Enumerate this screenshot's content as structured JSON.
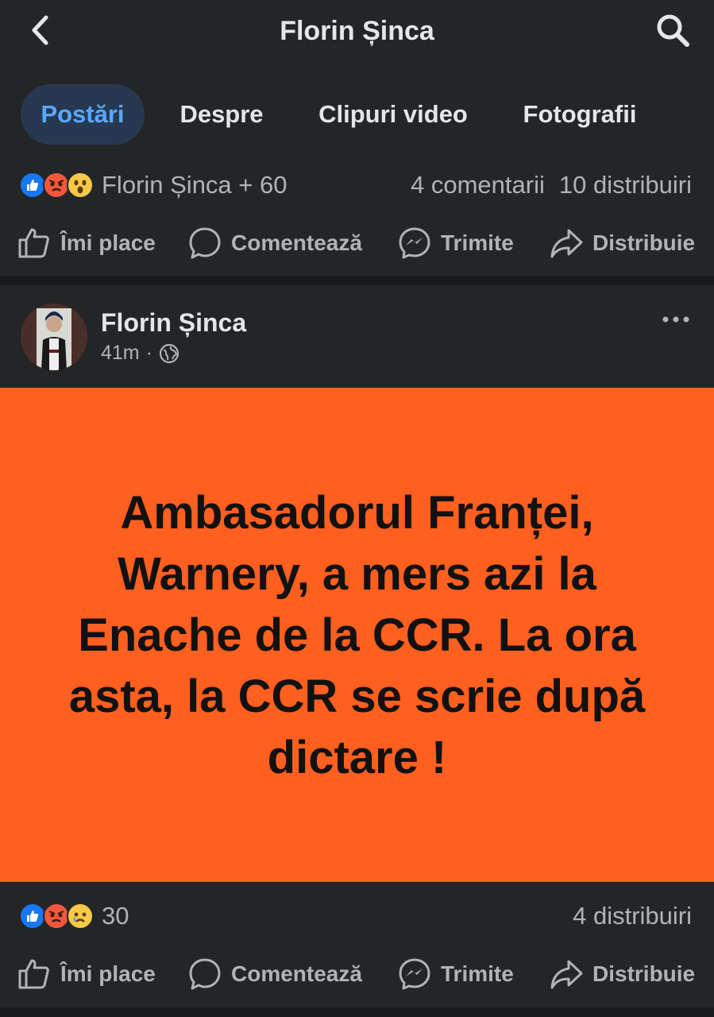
{
  "header": {
    "title": "Florin Șinca"
  },
  "tabs": [
    {
      "label": "Postări",
      "active": true
    },
    {
      "label": "Despre"
    },
    {
      "label": "Clipuri video"
    },
    {
      "label": "Fotografii"
    }
  ],
  "post1": {
    "reactions_text": "Florin Șinca + 60",
    "comments": "4 comentarii",
    "shares": "10 distribuiri",
    "reaction_icons": [
      "like-icon",
      "angry-icon",
      "wow-icon"
    ]
  },
  "actions": {
    "like": "Îmi place",
    "comment": "Comentează",
    "send": "Trimite",
    "share": "Distribuie"
  },
  "post2": {
    "author": "Florin Șinca",
    "time": "41m",
    "separator": "·",
    "image_text": "Ambasadorul Franței, Warnery, a mers azi la Enache de la CCR. La ora asta, la CCR se scrie după dictare !",
    "reactions_count": "30",
    "shares": "4 distribuiri",
    "reaction_icons": [
      "like-icon",
      "angry-icon",
      "sad-icon"
    ]
  },
  "colors": {
    "background": "#242526",
    "divider": "#18191a",
    "accent": "#5aa7ff",
    "active_tab_bg": "#263951",
    "post_image_bg": "#ff5f1f"
  }
}
